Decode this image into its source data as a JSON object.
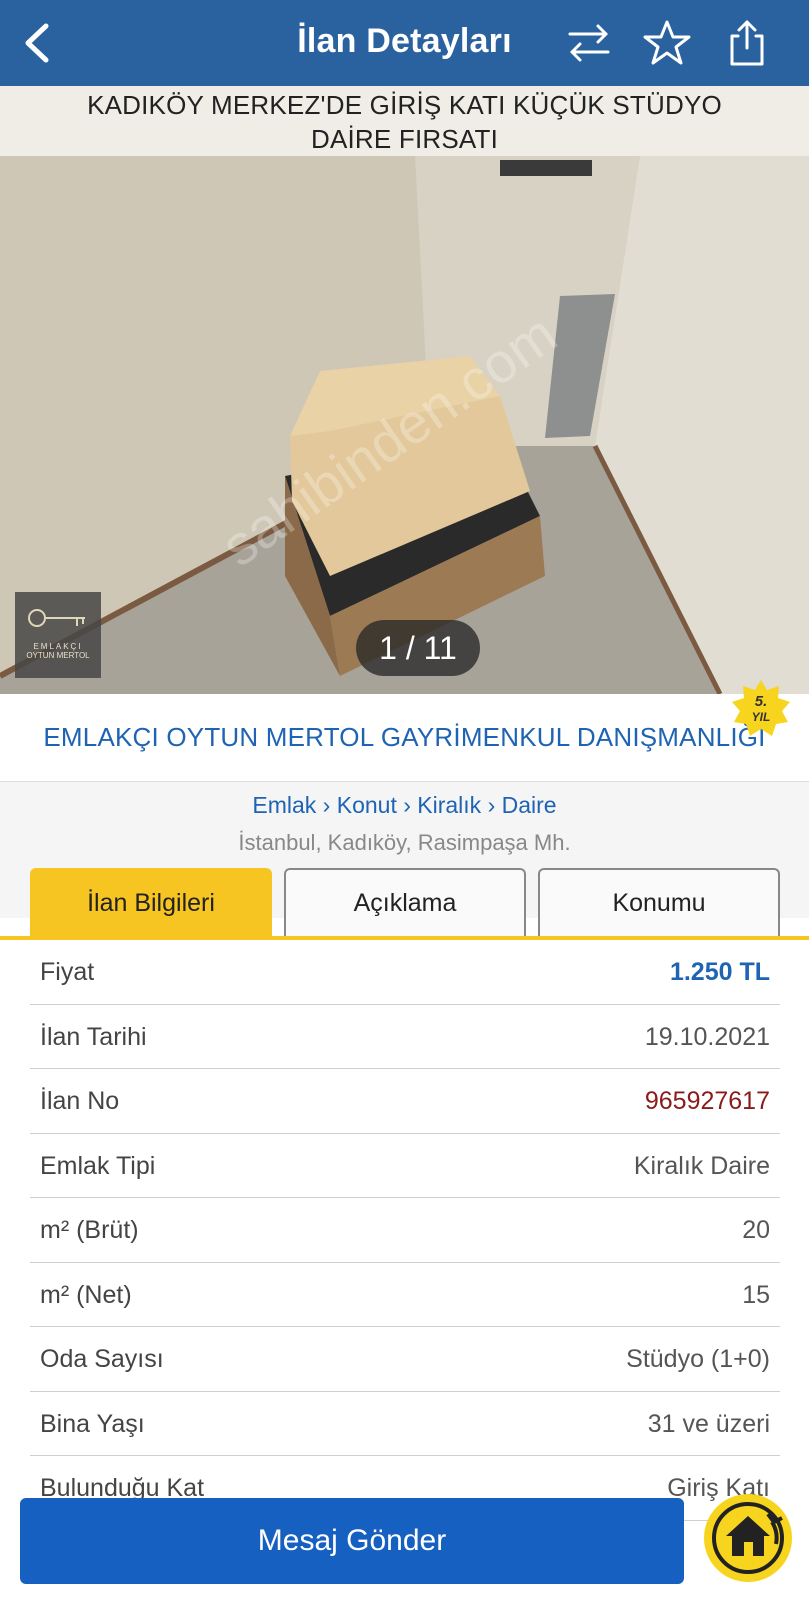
{
  "header": {
    "title": "İlan Detayları",
    "back_icon": "chevron-left-icon",
    "compare_icon": "swap-arrows-icon",
    "favorite_icon": "star-icon",
    "share_icon": "share-icon"
  },
  "ad": {
    "title_line1": "KADIKÖY MERKEZ'DE GİRİŞ KATI KÜÇÜK STÜDYO",
    "title_line2": "DAİRE FIRSATI",
    "photo_counter": "1 / 11",
    "watermark": "sahibinden.com",
    "logo_line1": "EMLAKÇI",
    "logo_line2": "OYTUN MERTOL"
  },
  "agency": {
    "name": "EMLAKÇI OYTUN MERTOL GAYRİMENKUL DANIŞMANLIĞI",
    "badge_line1": "5.",
    "badge_line2": "YIL"
  },
  "breadcrumb": {
    "path": "Emlak › Konut › Kiralık › Daire",
    "location": "İstanbul, Kadıköy, Rasimpaşa Mh."
  },
  "tabs": [
    {
      "label": "İlan Bilgileri",
      "active": true
    },
    {
      "label": "Açıklama",
      "active": false
    },
    {
      "label": "Konumu",
      "active": false
    }
  ],
  "details": [
    {
      "key": "Fiyat",
      "value": "1.250 TL"
    },
    {
      "key": "İlan Tarihi",
      "value": "19.10.2021"
    },
    {
      "key": "İlan No",
      "value": "965927617"
    },
    {
      "key": "Emlak Tipi",
      "value": "Kiralık Daire"
    },
    {
      "key": "m² (Brüt)",
      "value": "20"
    },
    {
      "key": "m² (Net)",
      "value": "15"
    },
    {
      "key": "Oda Sayısı",
      "value": "Stüdyo (1+0)"
    },
    {
      "key": "Bina Yaşı",
      "value": "31 ve üzeri"
    },
    {
      "key": "Bulunduğu Kat",
      "value": "Giriş Katı"
    }
  ],
  "bottom": {
    "message_button": "Mesaj Gönder",
    "home_icon": "home-icon"
  },
  "colors": {
    "header_bg": "#2a62a0",
    "accent_yellow": "#f7c522",
    "link_blue": "#1f63b3",
    "ad_no_red": "#8b1a1a",
    "button_blue": "#1560c0"
  }
}
